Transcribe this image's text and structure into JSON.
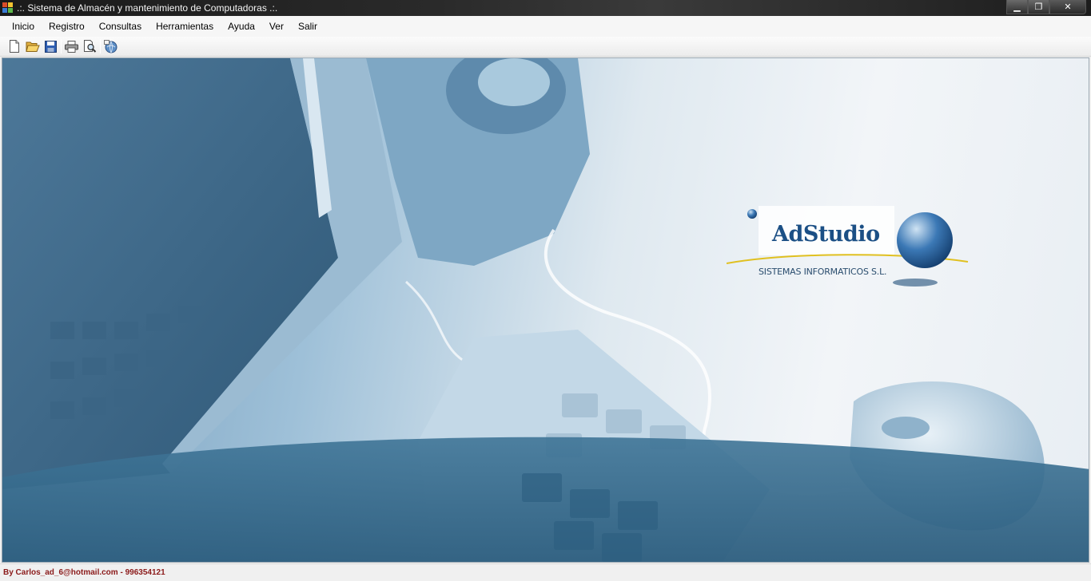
{
  "window": {
    "title": ".:. Sistema de Almacén y mantenimiento de Computadoras .:.",
    "minimize_glyph": "▁",
    "restore_glyph": "❐",
    "close_glyph": "✕"
  },
  "menu": {
    "items": [
      {
        "label": "Inicio"
      },
      {
        "label": "Registro"
      },
      {
        "label": "Consultas"
      },
      {
        "label": "Herramientas"
      },
      {
        "label": "Ayuda"
      },
      {
        "label": "Ver"
      },
      {
        "label": "Salir"
      }
    ]
  },
  "toolbar": {
    "buttons": [
      {
        "icon": "new-document-icon"
      },
      {
        "icon": "open-folder-icon"
      },
      {
        "icon": "save-icon"
      },
      {
        "icon": "print-icon"
      },
      {
        "icon": "print-preview-icon"
      },
      {
        "icon": "web-help-icon"
      }
    ]
  },
  "logo": {
    "brand": "AdStudio",
    "subtitle": "SISTEMAS INFORMATICOS S.L."
  },
  "status": {
    "text": "By Carlos_ad_6@hotmail.com - 996354121"
  },
  "colors": {
    "status_text": "#8b1a1a",
    "logo_blue": "#1b4f85",
    "background_blue": "#6f97b6"
  }
}
